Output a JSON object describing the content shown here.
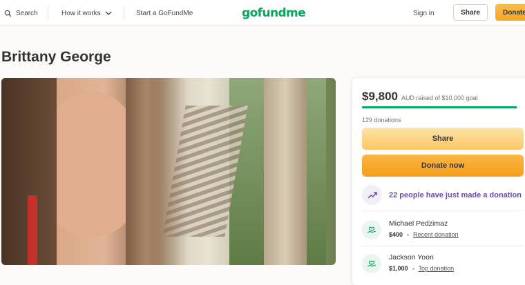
{
  "header": {
    "search_label": "Search",
    "how_it_works_label": "How it works",
    "start_label": "Start a GoFundMe",
    "logo_text": "gofundme",
    "sign_in_label": "Sign in",
    "share_label": "Share",
    "donate_label": "Donate"
  },
  "campaign": {
    "title": "Brittany George"
  },
  "card": {
    "raised_amount": "$9,800",
    "goal_text": "AUD raised of $10,000 goal",
    "progress_fraction": 0.98,
    "donations_count": "129 donations",
    "share_label": "Share",
    "donate_now_label": "Donate now",
    "trend_text": "22 people have just made a donation"
  },
  "donors": [
    {
      "name": "Michael Pedzimaz",
      "amount": "$400",
      "tag": "Recent donation"
    },
    {
      "name": "Jackson Yoon",
      "amount": "$1,000",
      "tag": "Top donation"
    }
  ],
  "colors": {
    "brand_green": "#02a95c",
    "donate_orange": "#f6a623",
    "trend_purple": "#6b4bb5"
  },
  "icons": {
    "search": "search-icon",
    "chevron": "chevron-down-icon",
    "trend": "trending-up-icon",
    "donor": "donor-hand-heart-icon"
  }
}
